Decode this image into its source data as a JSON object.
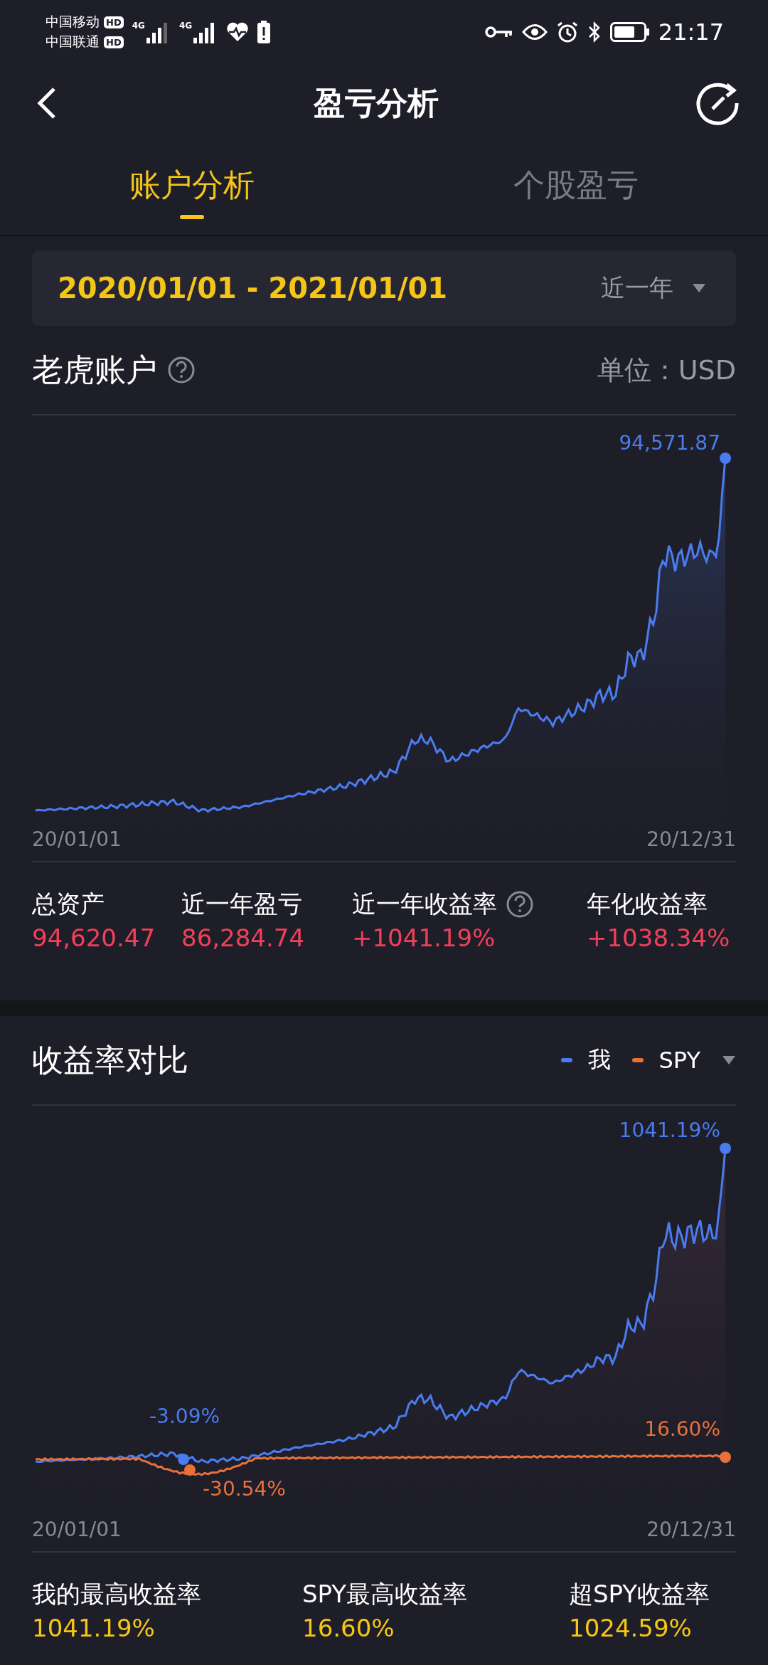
{
  "status_bar": {
    "carriers": [
      {
        "name": "中国移动",
        "badge": "HD"
      },
      {
        "name": "中国联通",
        "badge": "HD"
      }
    ],
    "networks": [
      "4G",
      "4G"
    ],
    "time": "21:17"
  },
  "header": {
    "title": "盈亏分析"
  },
  "tabs": [
    {
      "label": "账户分析",
      "selected": true
    },
    {
      "label": "个股盈亏",
      "selected": false
    }
  ],
  "date_range": {
    "value": "2020/01/01 - 2021/01/01",
    "period": "近一年"
  },
  "account": {
    "title": "老虎账户",
    "unit": "单位：USD",
    "chart": {
      "peak_label": "94,571.87",
      "x_start": "20/01/01",
      "x_end": "20/12/31"
    },
    "stats": [
      {
        "label": "总资产",
        "value": "94,620.47",
        "help": false
      },
      {
        "label": "近一年盈亏",
        "value": "86,284.74",
        "help": false
      },
      {
        "label": "近一年收益率",
        "value": "+1041.19%",
        "help": true
      },
      {
        "label": "年化收益率",
        "value": "+1038.34%",
        "help": false
      }
    ]
  },
  "comparison": {
    "title": "收益率对比",
    "legend": [
      {
        "name": "我",
        "color": "#4a7cf0"
      },
      {
        "name": "SPY",
        "color": "#e8703a"
      }
    ],
    "chart": {
      "me_peak": "1041.19%",
      "me_low": "-3.09%",
      "spy_low": "-30.54%",
      "spy_end": "16.60%",
      "x_start": "20/01/01",
      "x_end": "20/12/31"
    },
    "stats": [
      {
        "label": "我的最高收益率",
        "value": "1041.19%"
      },
      {
        "label": "SPY最高收益率",
        "value": "16.60%"
      },
      {
        "label": "超SPY收益率",
        "value": "1024.59%"
      }
    ]
  }
}
